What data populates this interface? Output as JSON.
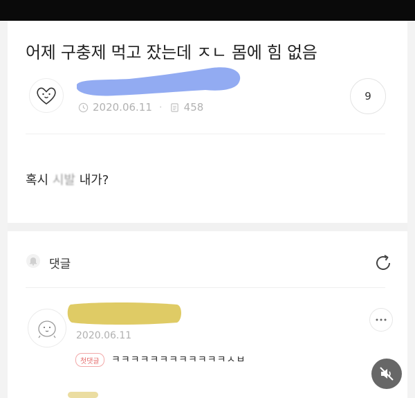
{
  "post": {
    "title": "어제 구충제 먹고 잤는데 ㅈㄴ 몸에 힘 없음",
    "date": "2020.06.11",
    "views": "458",
    "comment_count": "9",
    "body_prefix": "혹시 ",
    "body_blurred": "시발",
    "body_suffix": " 내가?"
  },
  "comments": {
    "label": "댓글",
    "items": [
      {
        "date": "2020.06.11",
        "badge": "첫댓글",
        "text": "ㅋㅋㅋㅋㅋㅋㅋㅋㅋㅋㅋㅋㅅㅂ"
      }
    ]
  },
  "icons": {
    "author_avatar": "heart-face-icon",
    "date": "clock-icon",
    "views": "document-icon",
    "comments_header": "bell-icon",
    "refresh": "refresh-icon",
    "commenter_avatar": "face-icon",
    "more": "more-dots-icon",
    "mute": "speaker-muted-icon"
  },
  "colors": {
    "author_name_redaction": "#7f9cf0",
    "commenter_name_redaction": "#d9c24a",
    "badge": "#e36a6a"
  }
}
